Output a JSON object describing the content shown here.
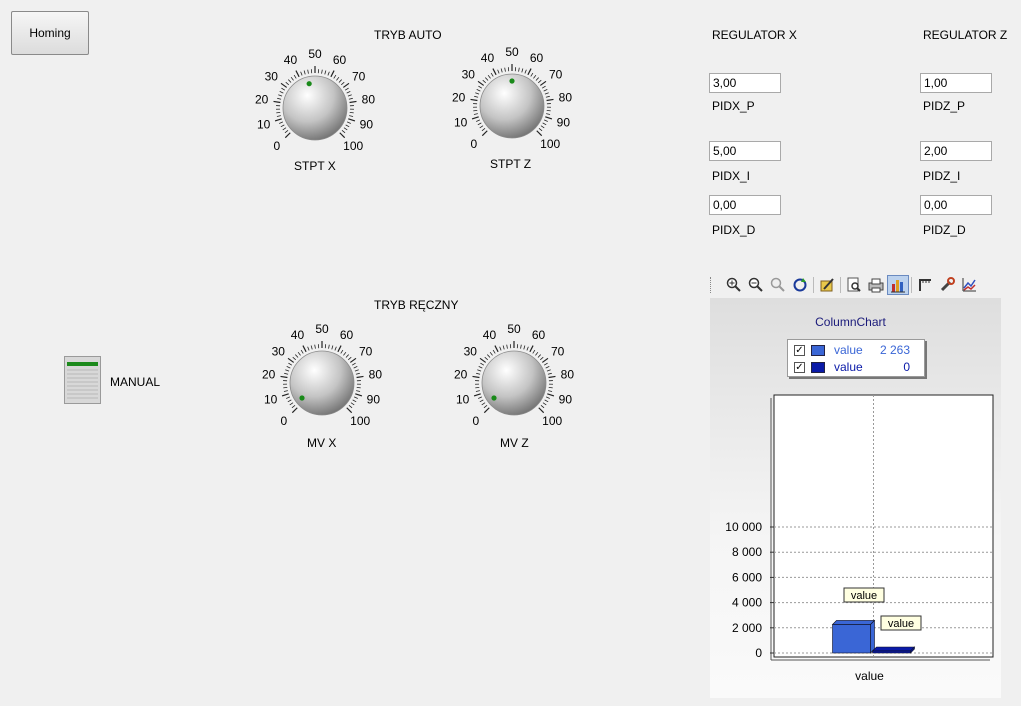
{
  "homing_button": "Homing",
  "auto_title": "TRYB AUTO",
  "manual_title": "TRYB RĘCZNY",
  "manual_switch_label": "MANUAL",
  "dial_scale": [
    "0",
    "10",
    "20",
    "30",
    "40",
    "50",
    "60",
    "70",
    "80",
    "90",
    "100"
  ],
  "knobs": {
    "stpt_x": {
      "label": "STPT X",
      "value": 45
    },
    "stpt_z": {
      "label": "STPT Z",
      "value": 50
    },
    "mv_x": {
      "label": "MV X",
      "value": 3
    },
    "mv_z": {
      "label": "MV Z",
      "value": 3
    }
  },
  "regulator_x": {
    "title": "REGULATOR X",
    "p": {
      "value": "3,00",
      "label": "PIDX_P"
    },
    "i": {
      "value": "5,00",
      "label": "PIDX_I"
    },
    "d": {
      "value": "0,00",
      "label": "PIDX_D"
    }
  },
  "regulator_z": {
    "title": "REGULATOR Z",
    "p": {
      "value": "1,00",
      "label": "PIDZ_P"
    },
    "i": {
      "value": "2,00",
      "label": "PIDZ_I"
    },
    "d": {
      "value": "0,00",
      "label": "PIDZ_D"
    }
  },
  "toolbar_icons": [
    "zoom-in-icon",
    "zoom-out-icon",
    "zoom-reset-icon",
    "refresh-icon",
    "edit-icon",
    "print-preview-icon",
    "print-icon",
    "chart-type-icon",
    "axis-icon",
    "wrench-icon",
    "series-icon"
  ],
  "colors": {
    "series1": "#3a66d6",
    "series2": "#0a1aa8",
    "knob_dot": "#1a8a1a",
    "title_blue": "#1a1a7a"
  },
  "chart_data": {
    "type": "bar",
    "title": "ColumnChart",
    "categories": [
      "value"
    ],
    "series": [
      {
        "name": "value",
        "values": [
          2263
        ],
        "legend_value": "2 263"
      },
      {
        "name": "value",
        "values": [
          0
        ],
        "legend_value": "0"
      }
    ],
    "ylim": [
      0,
      10000
    ],
    "yticks": [
      "0",
      "2 000",
      "4 000",
      "6 000",
      "8 000",
      "10 000"
    ],
    "tooltips": [
      "value",
      "value"
    ],
    "legend": "top",
    "grid": true
  }
}
